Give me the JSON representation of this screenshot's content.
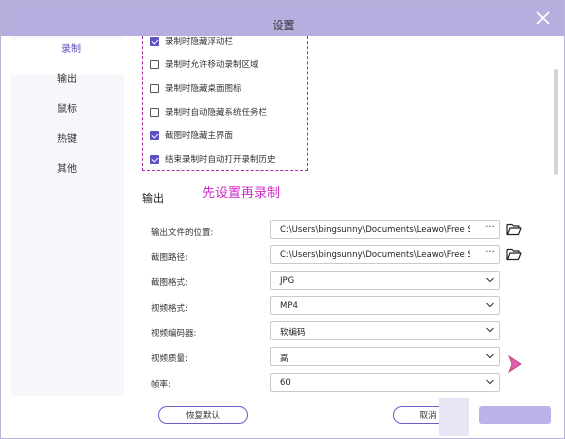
{
  "window": {
    "title": "设置"
  },
  "sidebar": {
    "items": [
      {
        "label": "录制",
        "active": true
      },
      {
        "label": "输出",
        "active": false
      },
      {
        "label": "鼠标",
        "active": false
      },
      {
        "label": "热键",
        "active": false
      },
      {
        "label": "其他",
        "active": false
      }
    ]
  },
  "recording_options": [
    {
      "label": "录制时隐藏浮动栏",
      "checked": true
    },
    {
      "label": "录制时允许移动录制区域",
      "checked": false
    },
    {
      "label": "录制时隐藏桌面图标",
      "checked": false
    },
    {
      "label": "录制时自动隐藏系统任务栏",
      "checked": false
    },
    {
      "label": "截图时隐藏主界面",
      "checked": true
    },
    {
      "label": "结束录制时自动打开录制历史",
      "checked": true
    }
  ],
  "annotation": "先设置再录制",
  "output": {
    "section_title": "输出",
    "output_location_label": "输出文件的位置:",
    "output_location_value": "C:\\Users\\bingsunny\\Documents\\Leawo\\Free S",
    "screenshot_path_label": "截图路径:",
    "screenshot_path_value": "C:\\Users\\bingsunny\\Documents\\Leawo\\Free S",
    "more_glyph": "···",
    "screenshot_format_label": "截图格式:",
    "screenshot_format_value": "JPG",
    "video_format_label": "视频格式:",
    "video_format_value": "MP4",
    "video_encoder_label": "视频编码器:",
    "video_encoder_value": "软编码",
    "video_quality_label": "视频质量:",
    "video_quality_value": "高",
    "frame_rate_label": "帧率:",
    "frame_rate_value": "60"
  },
  "footer": {
    "restore_label": "恢复默认",
    "cancel_label": "取消"
  },
  "colors": {
    "titlebar": "#b7aee0",
    "accent": "#5b52c4",
    "annotation": "#d12bc8"
  },
  "icons": [
    "close-icon",
    "folder-icon",
    "chevron-down-icon",
    "checkbox-icon",
    "cursor-arrow-icon"
  ]
}
